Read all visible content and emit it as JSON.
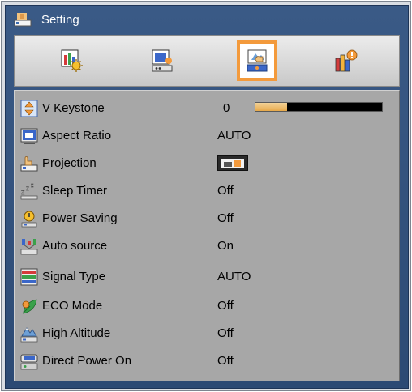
{
  "window": {
    "title": "Setting"
  },
  "tabs": [
    {
      "id": "image",
      "icon": "image-settings-icon"
    },
    {
      "id": "display",
      "icon": "display-settings-icon"
    },
    {
      "id": "setup",
      "icon": "setup-settings-icon",
      "selected": true
    },
    {
      "id": "options",
      "icon": "options-settings-icon"
    }
  ],
  "menu": [
    {
      "label": "V Keystone",
      "value": "0",
      "icon": "keystone-icon",
      "slider_fraction": 0.25
    },
    {
      "label": "Aspect Ratio",
      "value": "AUTO",
      "icon": "aspect-ratio-icon"
    },
    {
      "label": "Projection",
      "value": "",
      "icon": "projection-icon"
    },
    {
      "label": "Sleep Timer",
      "value": "Off",
      "icon": "sleep-timer-icon"
    },
    {
      "label": "Power Saving",
      "value": "Off",
      "icon": "power-saving-icon"
    },
    {
      "label": "Auto source",
      "value": "On",
      "icon": "auto-source-icon"
    },
    {
      "label": "Signal Type",
      "value": "AUTO",
      "icon": "signal-type-icon"
    },
    {
      "label": "ECO Mode",
      "value": "Off",
      "icon": "eco-mode-icon"
    },
    {
      "label": "High Altitude",
      "value": "Off",
      "icon": "high-altitude-icon"
    },
    {
      "label": "Direct Power On",
      "value": "Off",
      "icon": "direct-power-on-icon"
    }
  ],
  "colors": {
    "window_blue": "#2f4f7b",
    "panel_gray": "#a7a7a7",
    "selection_orange": "#f39a3c",
    "slider_fill": "#e7a94a"
  }
}
